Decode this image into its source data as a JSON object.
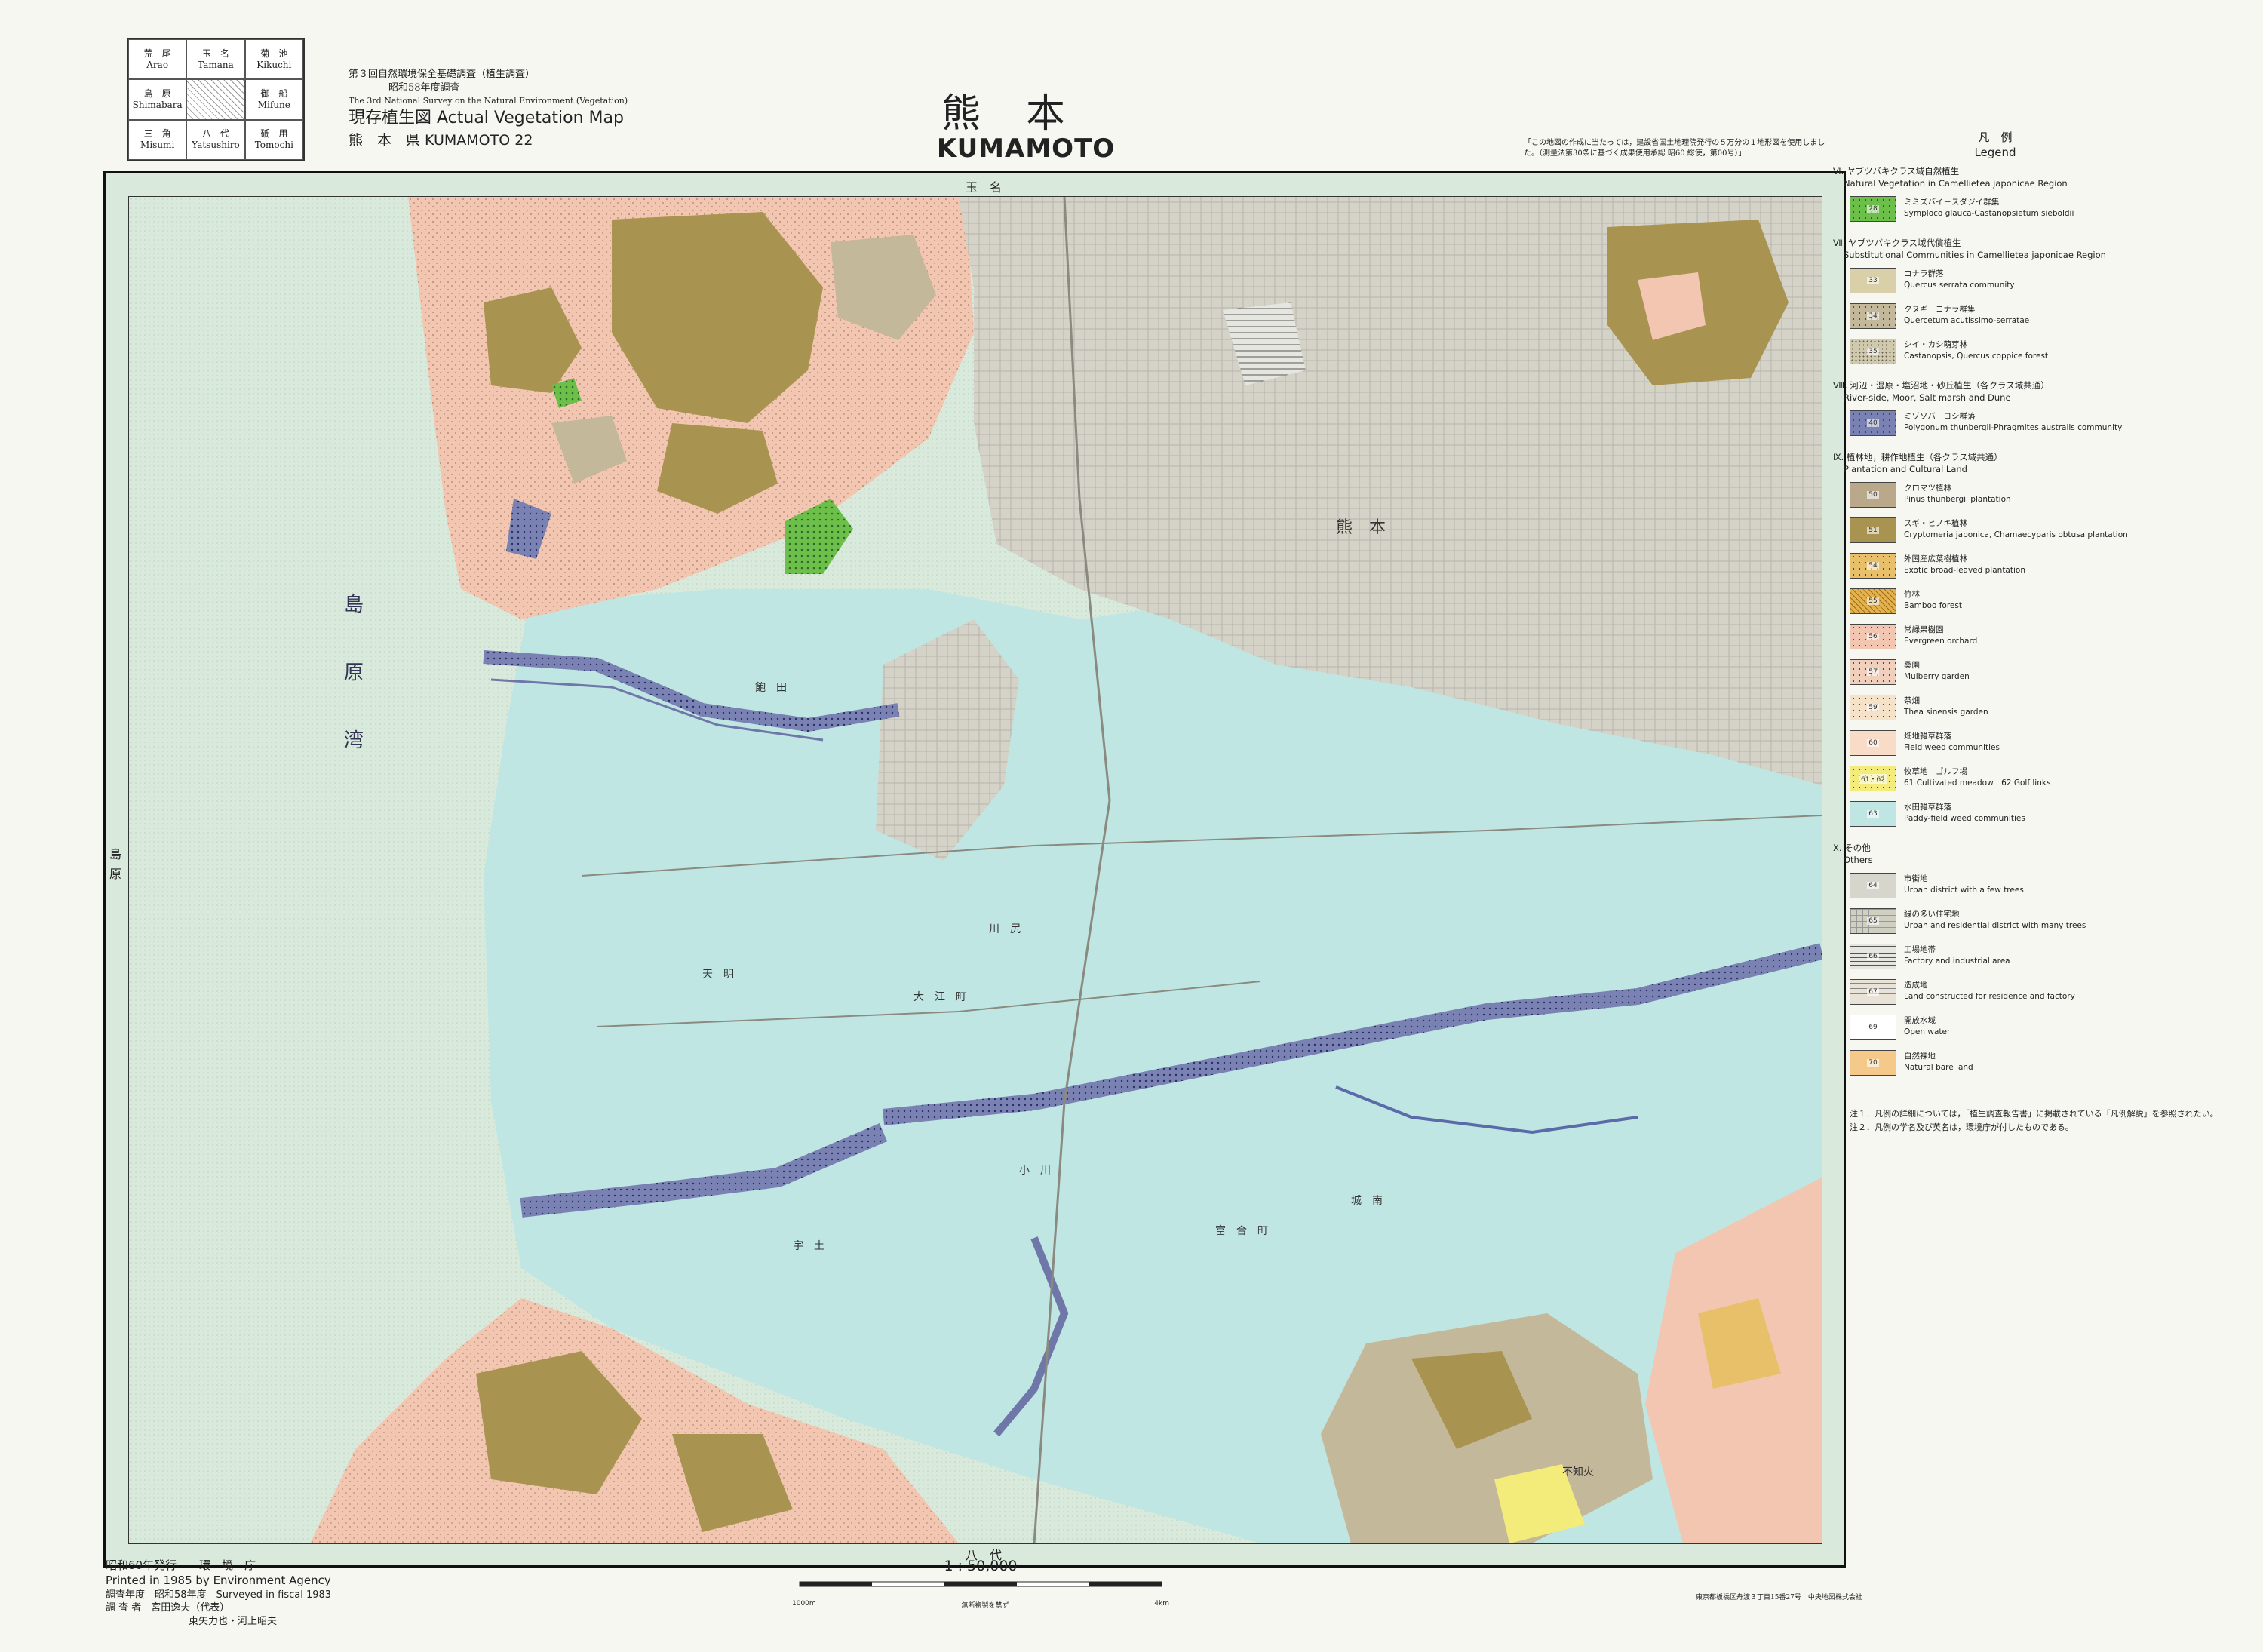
{
  "index_sheets": [
    {
      "jp": "荒　尾",
      "en": "Arao"
    },
    {
      "jp": "玉　名",
      "en": "Tamana"
    },
    {
      "jp": "菊　池",
      "en": "Kikuchi"
    },
    {
      "jp": "島　原",
      "en": "Shimabara"
    },
    {
      "jp": "",
      "en": ""
    },
    {
      "jp": "御　船",
      "en": "Mifune"
    },
    {
      "jp": "三　角",
      "en": "Misumi"
    },
    {
      "jp": "八　代",
      "en": "Yatsushiro"
    },
    {
      "jp": "砥　用",
      "en": "Tomochi"
    }
  ],
  "survey": {
    "line1": "第３回自然環境保全基礎調査（植生調査）",
    "line2": "—昭和58年度調査—",
    "line3": "The 3rd National Survey on the Natural Environment (Vegetation)",
    "title": "現存植生図 Actual Vegetation Map",
    "sheet": "熊　本　県 KUMAMOTO 22"
  },
  "map_title": {
    "jp": "熊本",
    "en": "KUMAMOTO"
  },
  "copyright_note": "「この地図の作成に当たっては，建設省国土地理院発行の５万分の１地形図を使用しました。（測量法第30条に基づく成果使用承認 昭60 総使，第00号）」",
  "map_labels": {
    "top_center": "玉　名",
    "bottom_center": "八　代",
    "left_edge": "島　原",
    "bay": [
      "島",
      "原",
      "湾"
    ],
    "places": [
      "大　江　町",
      "飽　田",
      "天　明",
      "富　合　町",
      "城　南",
      "熊　本",
      "小　川",
      "川　尻",
      "宇　土",
      "不知火"
    ]
  },
  "legend": {
    "title_jp": "凡　例",
    "title_en": "Legend",
    "sections": [
      {
        "jp": "Ⅵ. ヤブツバキクラス域自然植生",
        "en": "Natural Vegetation in Camellietea japonicae Region",
        "items": [
          {
            "code": "28",
            "jp": "ミミズバイ－スダジイ群集",
            "en": "Symploco glauca-Castanopsietum sieboldii",
            "color": "#6cc04a",
            "pattern": "dots"
          }
        ]
      },
      {
        "jp": "Ⅶ. ヤブツバキクラス域代償植生",
        "en": "Substitutional Communities in Camellietea japonicae Region",
        "items": [
          {
            "code": "33",
            "jp": "コナラ群落",
            "en": "Quercus serrata community",
            "color": "#d9cfa8",
            "pattern": "none"
          },
          {
            "code": "34",
            "jp": "クヌギ－コナラ群集",
            "en": "Quercetum acutissimo-serratae",
            "color": "#c4b89a",
            "pattern": "dots"
          },
          {
            "code": "35",
            "jp": "シイ・カシ萌芽林",
            "en": "Castanopsis, Quercus coppice forest",
            "color": "#cfc9ad",
            "pattern": "fine"
          }
        ]
      },
      {
        "jp": "Ⅷ. 河辺・湿原・塩沼地・砂丘植生（各クラス域共通）",
        "en": "River-side, Moor, Salt marsh and Dune",
        "items": [
          {
            "code": "40",
            "jp": "ミゾソバ－ヨシ群落",
            "en": "Polygonum thunbergii-Phragmites australis community",
            "color": "#7a82b3",
            "pattern": "dots"
          }
        ]
      },
      {
        "jp": "Ⅸ. 植林地，耕作地植生（各クラス域共通）",
        "en": "Plantation and Cultural Land",
        "items": [
          {
            "code": "50",
            "jp": "クロマツ植林",
            "en": "Pinus thunbergii plantation",
            "color": "#b9a88a",
            "pattern": "none"
          },
          {
            "code": "51",
            "jp": "スギ・ヒノキ植林",
            "en": "Cryptomeria japonica, Chamaecyparis obtusa plantation",
            "color": "#a89450",
            "pattern": "none"
          },
          {
            "code": "54",
            "jp": "外国産広葉樹植林",
            "en": "Exotic broad-leaved plantation",
            "color": "#e8c06a",
            "pattern": "dots"
          },
          {
            "code": "55",
            "jp": "竹林",
            "en": "Bamboo forest",
            "color": "#e3b24a",
            "pattern": "hatch"
          },
          {
            "code": "56",
            "jp": "常緑果樹園",
            "en": "Evergreen orchard",
            "color": "#f2c6b0",
            "pattern": "dots"
          },
          {
            "code": "57",
            "jp": "桑園",
            "en": "Mulberry garden",
            "color": "#f0d0bc",
            "pattern": "dots"
          },
          {
            "code": "59",
            "jp": "茶畑",
            "en": "Thea sinensis garden",
            "color": "#f5e2c8",
            "pattern": "dots"
          },
          {
            "code": "60",
            "jp": "畑地雑草群落",
            "en": "Field weed communities",
            "color": "#f8dcc8",
            "pattern": "none"
          },
          {
            "code": "61・62",
            "jp": "牧草地　ゴルフ場",
            "en": "61 Cultivated meadow　62 Golf links",
            "color": "#f3ec7a",
            "pattern": "dots"
          },
          {
            "code": "63",
            "jp": "水田雑草群落",
            "en": "Paddy-field weed communities",
            "color": "#bfe6e3",
            "pattern": "none"
          }
        ]
      },
      {
        "jp": "Ⅹ. その他",
        "en": "Others",
        "items": [
          {
            "code": "64",
            "jp": "市街地",
            "en": "Urban district with a few trees",
            "color": "#d7d6cc",
            "pattern": "none"
          },
          {
            "code": "65",
            "jp": "緑の多い住宅地",
            "en": "Urban and residential district with many trees",
            "color": "#cfd0c2",
            "pattern": "grid"
          },
          {
            "code": "66",
            "jp": "工場地帯",
            "en": "Factory and industrial area",
            "color": "#e6e6e0",
            "pattern": "lines"
          },
          {
            "code": "67",
            "jp": "造成地",
            "en": "Land constructed for residence and factory",
            "color": "#e8e3d6",
            "pattern": "dashes"
          },
          {
            "code": "69",
            "jp": "開放水域",
            "en": "Open water",
            "color": "#ffffff",
            "pattern": "none"
          },
          {
            "code": "70",
            "jp": "自然裸地",
            "en": "Natural bare land",
            "color": "#f4c98a",
            "pattern": "none"
          }
        ]
      }
    ]
  },
  "notes": [
    "注１．凡例の詳細については，「植生調査報告書」に掲載されている「凡例解説」を参照されたい。",
    "注２．凡例の学名及び英名は，環境庁が付したものである。"
  ],
  "publisher": {
    "issued_jp": "昭和60年発行　　環　境　庁",
    "printed_en": "Printed in 1985 by Environment Agency",
    "surveyed": "調査年度　昭和58年度　Surveyed in fiscal 1983",
    "surveyors": "調 査 者　宮田逸夫（代表）",
    "surveyors2": "東矢力也・河上昭夫"
  },
  "scale": {
    "text": "1 : 50,000",
    "left_label": "1000m",
    "right_label": "4km",
    "note": "無断複製を禁ず"
  },
  "printer_note": "東京都板橋区舟渡３丁目15番27号　中央地図株式会社",
  "colors": {
    "paddy": "#bfe6e3",
    "urban": "#d7d6cc",
    "plantation": "#a89450",
    "orchard": "#f2c6b0",
    "coppice": "#c4b89a",
    "natural": "#6cc04a",
    "river": "#7a82b3",
    "sea": "#d9eadc"
  }
}
